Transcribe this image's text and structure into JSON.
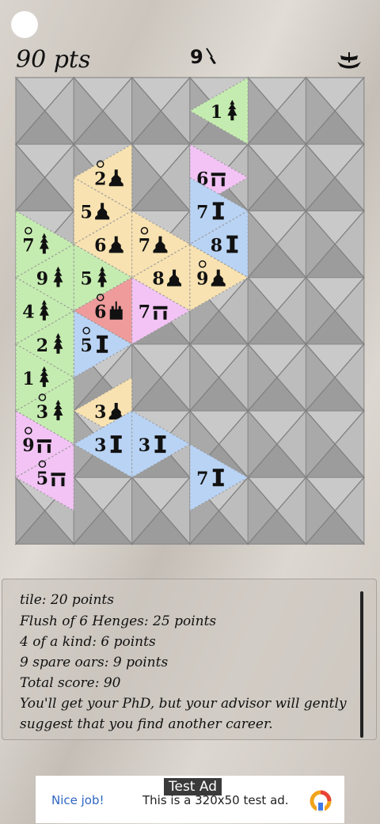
{
  "header": {
    "score": "90 pts",
    "oars_count": "9",
    "oar_icon": "oar-icon",
    "boat_icon": "boat-icon"
  },
  "colors": {
    "empty_tile": "#b4b4b4",
    "green": "#c5ecb0",
    "yellow": "#f8e2b1",
    "pink": "#f2c3f4",
    "blue": "#b9d3f4",
    "red": "#ef9b9b"
  },
  "board": {
    "rows": 13,
    "cols": 12,
    "tiles": [
      {
        "row": 1,
        "col": 7,
        "color": "green",
        "symbol": "pagoda",
        "number": "1"
      },
      {
        "row": 3,
        "col": 3,
        "color": "yellow",
        "symbol": "temple",
        "number": "2",
        "mark": "waves"
      },
      {
        "row": 3,
        "col": 6,
        "color": "pink",
        "symbol": "henge",
        "number": "6"
      },
      {
        "row": 4,
        "col": 2,
        "color": "yellow",
        "symbol": "temple",
        "number": "5"
      },
      {
        "row": 4,
        "col": 6,
        "color": "blue",
        "symbol": "pillar",
        "number": "7"
      },
      {
        "row": 5,
        "col": 0,
        "color": "green",
        "symbol": "pagoda",
        "number": "7",
        "mark": "ram"
      },
      {
        "row": 5,
        "col": 3,
        "color": "yellow",
        "symbol": "temple",
        "number": "6"
      },
      {
        "row": 5,
        "col": 4,
        "color": "yellow",
        "symbol": "temple",
        "number": "7",
        "mark": "ram"
      },
      {
        "row": 5,
        "col": 7,
        "color": "blue",
        "symbol": "pillar",
        "number": "8"
      },
      {
        "row": 6,
        "col": 1,
        "color": "green",
        "symbol": "pagoda",
        "number": "9"
      },
      {
        "row": 6,
        "col": 2,
        "color": "green",
        "symbol": "pagoda",
        "number": "5"
      },
      {
        "row": 6,
        "col": 5,
        "color": "yellow",
        "symbol": "temple",
        "number": "8"
      },
      {
        "row": 6,
        "col": 6,
        "color": "yellow",
        "symbol": "temple",
        "number": "9",
        "mark": "scales"
      },
      {
        "row": 7,
        "col": 0,
        "color": "green",
        "symbol": "pagoda",
        "number": "4"
      },
      {
        "row": 7,
        "col": 3,
        "color": "red",
        "symbol": "castle",
        "number": "6",
        "mark": "scroll"
      },
      {
        "row": 7,
        "col": 4,
        "color": "pink",
        "symbol": "henge",
        "number": "7"
      },
      {
        "row": 8,
        "col": 1,
        "color": "green",
        "symbol": "pagoda",
        "number": "2"
      },
      {
        "row": 8,
        "col": 2,
        "color": "blue",
        "symbol": "pillar",
        "number": "5",
        "mark": "scales"
      },
      {
        "row": 9,
        "col": 0,
        "color": "green",
        "symbol": "pagoda",
        "number": "1"
      },
      {
        "row": 10,
        "col": 1,
        "color": "green",
        "symbol": "pagoda",
        "number": "3",
        "mark": "eye"
      },
      {
        "row": 10,
        "col": 3,
        "color": "yellow",
        "symbol": "temple",
        "number": "3"
      },
      {
        "row": 11,
        "col": 0,
        "color": "pink",
        "symbol": "henge",
        "number": "9",
        "mark": "eye"
      },
      {
        "row": 11,
        "col": 3,
        "color": "blue",
        "symbol": "pillar",
        "number": "3"
      },
      {
        "row": 11,
        "col": 4,
        "color": "blue",
        "symbol": "pillar",
        "number": "3"
      },
      {
        "row": 12,
        "col": 1,
        "color": "pink",
        "symbol": "henge",
        "number": "5",
        "mark": "eye"
      },
      {
        "row": 12,
        "col": 6,
        "color": "blue",
        "symbol": "pillar",
        "number": "7"
      }
    ]
  },
  "results": {
    "lines": [
      "tile: 20 points",
      "Flush of 6 Henges: 25 points",
      "4 of a kind: 6 points",
      "9 spare oars: 9 points",
      "Total score: 90",
      "You'll get your PhD, but your advisor will gently",
      "suggest that you find another career."
    ]
  },
  "ad": {
    "tag": "Test Ad",
    "left_text": "Nice job!",
    "body_text": "This is a 320x50 test ad.",
    "logo_icon": "ad-network-logo-icon"
  }
}
